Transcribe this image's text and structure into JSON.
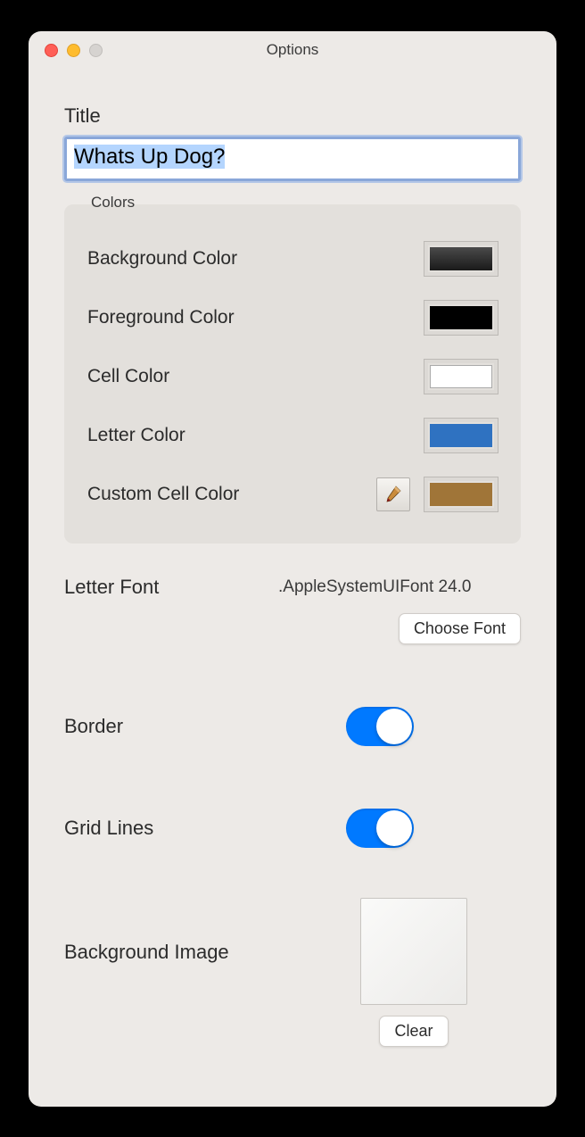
{
  "window": {
    "title": "Options"
  },
  "section": {
    "title_label": "Title",
    "title_value": "Whats Up Dog?"
  },
  "colors": {
    "legend": "Colors",
    "background_label": "Background Color",
    "foreground_label": "Foreground Color",
    "cell_label": "Cell Color",
    "letter_label": "Letter Color",
    "custom_label": "Custom Cell Color",
    "background_value": "#2a2a2a",
    "foreground_value": "#000000",
    "cell_value": "#ffffff",
    "letter_value": "#2f72c1",
    "custom_value": "#a07538"
  },
  "font": {
    "label": "Letter Font",
    "value": ".AppleSystemUIFont 24.0",
    "choose_button": "Choose Font"
  },
  "border": {
    "label": "Border",
    "on": true
  },
  "gridlines": {
    "label": "Grid Lines",
    "on": true
  },
  "bgimage": {
    "label": "Background Image",
    "clear_button": "Clear"
  }
}
